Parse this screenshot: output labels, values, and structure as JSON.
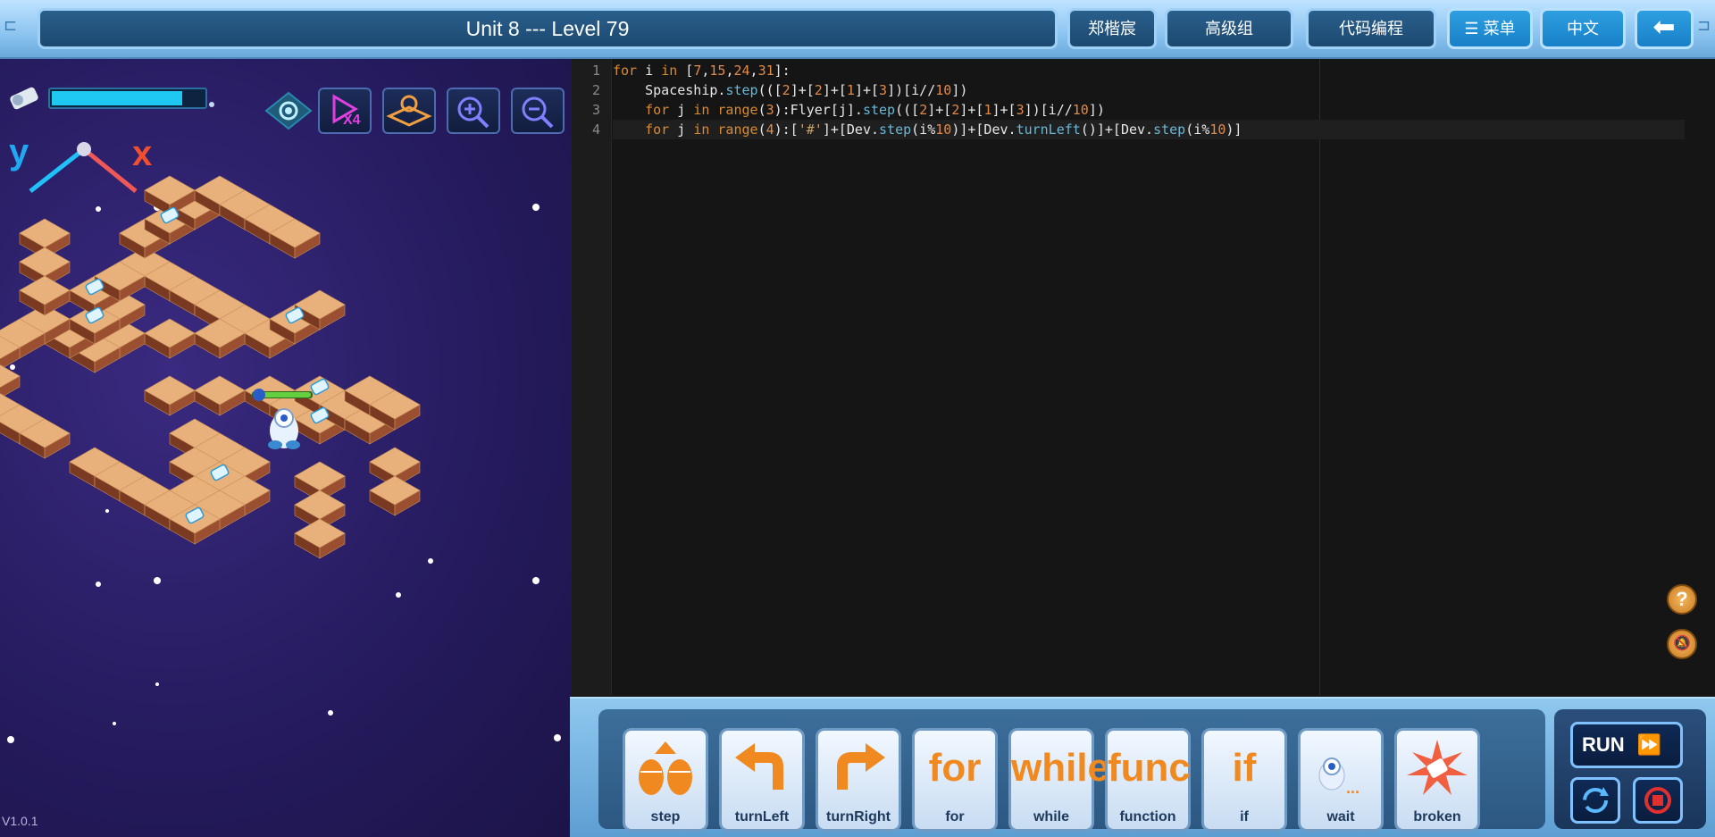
{
  "header": {
    "title": "Unit 8 --- Level 79",
    "user_name": "郑楷宸",
    "group": "高级组",
    "mode": "代码编程",
    "menu_label": "菜单",
    "language": "中文"
  },
  "game": {
    "energy_level": 0.85,
    "axis_y_label": "y",
    "axis_x_label": "x",
    "speed_label": "X4",
    "version": "V1.0.1"
  },
  "editor": {
    "lines": [
      {
        "num": "1",
        "text": "for i in [7,15,24,31]:"
      },
      {
        "num": "2",
        "text": "    Spaceship.step(([2]+[2]+[1]+[3])[i//10])"
      },
      {
        "num": "3",
        "text": "    for j in range(3):Flyer[j].step(([2]+[2]+[1]+[3])[i//10])"
      },
      {
        "num": "4",
        "text": "    for j in range(4):['#']+[Dev.step(i%10)]+[Dev.turnLeft()]+[Dev.step(i%10)]"
      }
    ]
  },
  "palette": {
    "blocks": [
      {
        "label": "step",
        "art": "step-icon"
      },
      {
        "label": "turnLeft",
        "art": "turn-left-icon"
      },
      {
        "label": "turnRight",
        "art": "turn-right-icon"
      },
      {
        "label": "for",
        "art": "for"
      },
      {
        "label": "while",
        "art": "while"
      },
      {
        "label": "function",
        "art": "func"
      },
      {
        "label": "if",
        "art": "if"
      },
      {
        "label": "wait",
        "art": "wait-icon"
      },
      {
        "label": "broken",
        "art": "broken-icon"
      }
    ],
    "run_label": "RUN"
  },
  "colors": {
    "accent": "#1ec8f0",
    "block_orange": "#f08a20",
    "space_bg": "#241a5c"
  }
}
